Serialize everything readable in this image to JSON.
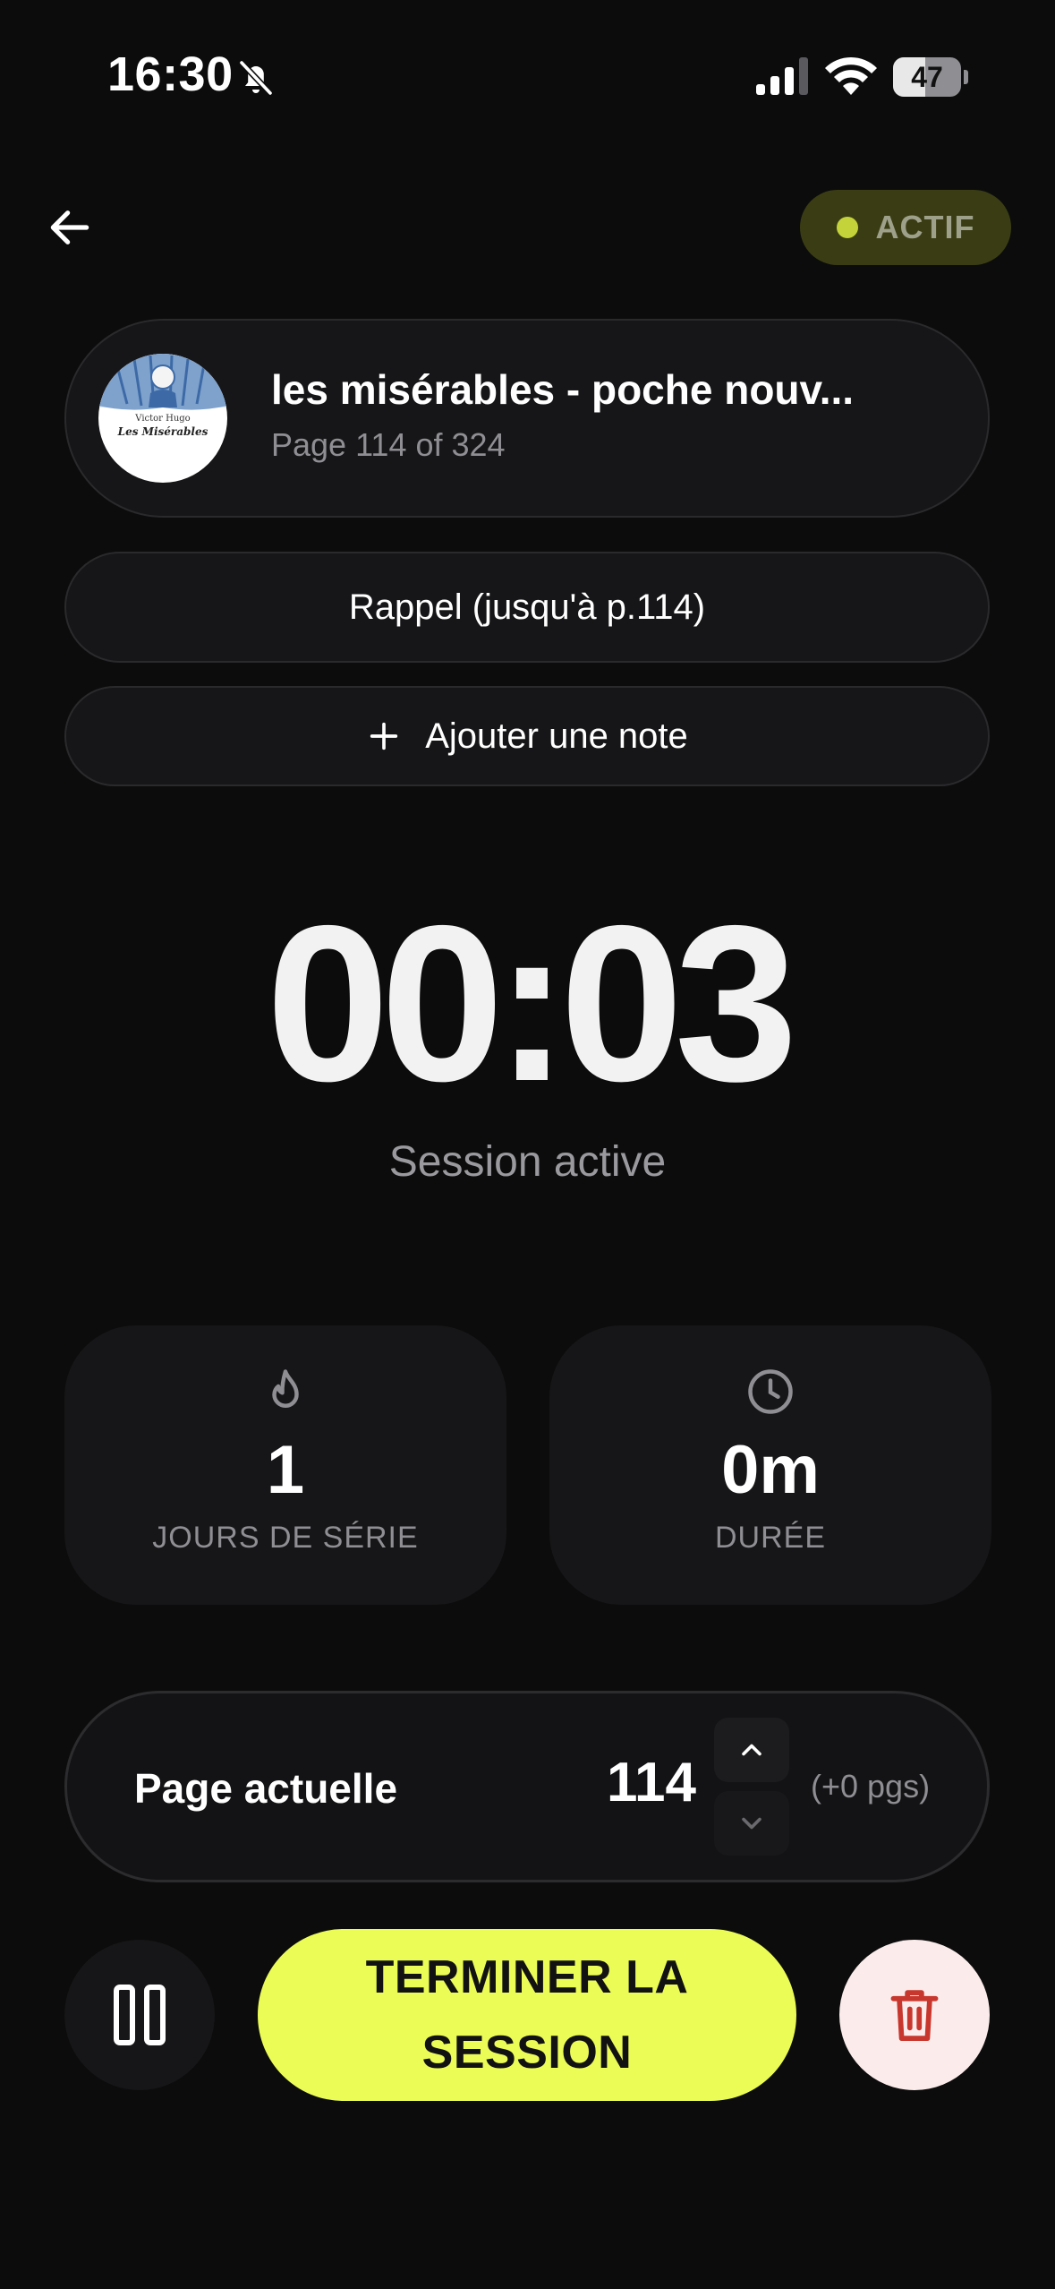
{
  "status_bar": {
    "time": "16:30",
    "battery": "47",
    "battery_level": 0.47,
    "icons": [
      "bell-slash-icon",
      "signal-icon",
      "wifi-icon",
      "battery-icon"
    ]
  },
  "header": {
    "back_icon": "arrow-left-icon",
    "status_label": "ACTIF",
    "status_color": "#c3d339"
  },
  "book": {
    "title": "les misérables - poche nouv...",
    "progress": "Page 114 of 324",
    "cover_author": "Victor Hugo",
    "cover_title": "Les Misérables"
  },
  "actions": {
    "rappel_label": "Rappel (jusqu'à p.114)",
    "note_label": "Ajouter une note",
    "note_icon": "plus-icon"
  },
  "timer": {
    "value": "00:03",
    "subtitle": "Session active"
  },
  "stats": [
    {
      "icon": "flame-icon",
      "value": "1",
      "label": "JOURS DE SÉRIE"
    },
    {
      "icon": "clock-icon",
      "value": "0m",
      "label": "DURÉE"
    }
  ],
  "page_tracker": {
    "label": "Page actuelle",
    "value": "114",
    "delta": "(+0 pgs)"
  },
  "bottom": {
    "pause_icon": "pause-icon",
    "finish_label": "TERMINER LA SESSION",
    "finish_color": "#ebfc57",
    "delete_icon": "trash-icon",
    "delete_color": "#c8372d"
  }
}
